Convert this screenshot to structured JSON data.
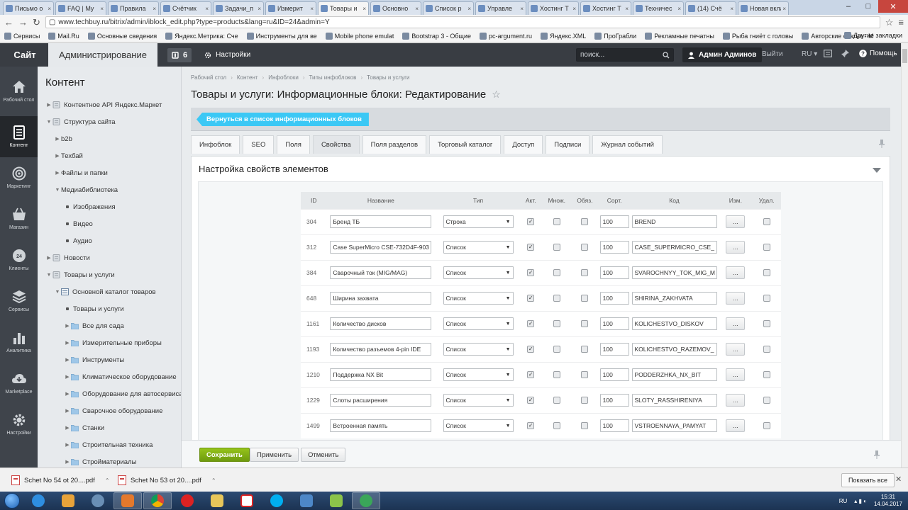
{
  "browser": {
    "tabs": [
      {
        "title": "Письмо о"
      },
      {
        "title": "FAQ | My"
      },
      {
        "title": "Правила"
      },
      {
        "title": "Счётчик"
      },
      {
        "title": "Задачи_п"
      },
      {
        "title": "Измерит"
      },
      {
        "title": "Товары и"
      },
      {
        "title": "Основно"
      },
      {
        "title": "Список р"
      },
      {
        "title": "Управле"
      },
      {
        "title": "Хостинг T"
      },
      {
        "title": "Хостинг T"
      },
      {
        "title": "Техничес"
      },
      {
        "title": "(14) Счё"
      },
      {
        "title": "Новая вклад"
      }
    ],
    "url": "www.techbuy.ru/bitrix/admin/iblock_edit.php?type=products&lang=ru&ID=24&admin=Y",
    "bookmarks": [
      "Сервисы",
      "Mail.Ru",
      "Основные сведения",
      "Яндекс.Метрика: Сче",
      "Инструменты для ве",
      "Mobile phone emulat",
      "Bootstrap 3 - Общие",
      "pc-argument.ru",
      "Яндекс.XML",
      "ПроГрабли",
      "Рекламные печатны",
      "Рыба гниёт с головы",
      "Авторские статьи - М"
    ],
    "other_bookmarks": "Другие закладки"
  },
  "topbar": {
    "site": "Сайт",
    "admin": "Администрирование",
    "notifications": "6",
    "settings": "Настройки",
    "search_placeholder": "поиск...",
    "user": "Админ Админов",
    "logout": "Выйти",
    "lang": "RU",
    "help": "Помощь"
  },
  "leftnav": [
    {
      "label": "Рабочий стол",
      "icon": "home-icon"
    },
    {
      "label": "Контент",
      "icon": "document-icon"
    },
    {
      "label": "Маркетинг",
      "icon": "target-icon"
    },
    {
      "label": "Магазин",
      "icon": "basket-icon"
    },
    {
      "label": "Клиенты",
      "icon": "clients-icon"
    },
    {
      "label": "Сервисы",
      "icon": "layers-icon"
    },
    {
      "label": "Аналитика",
      "icon": "chart-icon"
    },
    {
      "label": "Marketplace",
      "icon": "cloud-icon"
    },
    {
      "label": "Настройки",
      "icon": "gear-icon"
    }
  ],
  "tree": {
    "title": "Контент",
    "items": [
      {
        "label": "Контентное API Яндекс.Маркет",
        "level": 0,
        "icon": "page",
        "arrow": "right"
      },
      {
        "label": "Структура сайта",
        "level": 0,
        "icon": "page",
        "arrow": "down"
      },
      {
        "label": "b2b",
        "level": 1,
        "icon": "none",
        "arrow": "right"
      },
      {
        "label": "Техбай",
        "level": 1,
        "icon": "none",
        "arrow": "right"
      },
      {
        "label": "Файлы и папки",
        "level": 1,
        "icon": "none",
        "arrow": "right"
      },
      {
        "label": "Медиабиблиотека",
        "level": 1,
        "icon": "none",
        "arrow": "down"
      },
      {
        "label": "Изображения",
        "level": 2,
        "icon": "dot",
        "arrow": "none"
      },
      {
        "label": "Видео",
        "level": 2,
        "icon": "dot",
        "arrow": "none"
      },
      {
        "label": "Аудио",
        "level": 2,
        "icon": "dot",
        "arrow": "none"
      },
      {
        "label": "Новости",
        "level": 0,
        "icon": "page",
        "arrow": "right"
      },
      {
        "label": "Товары и услуги",
        "level": 0,
        "icon": "page",
        "arrow": "down"
      },
      {
        "label": "Основной каталог товаров",
        "level": 1,
        "icon": "catalog",
        "arrow": "down"
      },
      {
        "label": "Товары и услуги",
        "level": 2,
        "icon": "dot",
        "arrow": "none"
      },
      {
        "label": "Все для сада",
        "level": 2,
        "icon": "folder",
        "arrow": "right"
      },
      {
        "label": "Измерительные приборы",
        "level": 2,
        "icon": "folder",
        "arrow": "right"
      },
      {
        "label": "Инструменты",
        "level": 2,
        "icon": "folder",
        "arrow": "right"
      },
      {
        "label": "Климатическое оборудование",
        "level": 2,
        "icon": "folder",
        "arrow": "right"
      },
      {
        "label": "Оборудование для автосервиса",
        "level": 2,
        "icon": "folder",
        "arrow": "right"
      },
      {
        "label": "Сварочное оборудование",
        "level": 2,
        "icon": "folder",
        "arrow": "right"
      },
      {
        "label": "Станки",
        "level": 2,
        "icon": "folder",
        "arrow": "right"
      },
      {
        "label": "Строительная техника",
        "level": 2,
        "icon": "folder",
        "arrow": "right"
      },
      {
        "label": "Стройматериалы",
        "level": 2,
        "icon": "folder",
        "arrow": "right"
      }
    ]
  },
  "breadcrumb": [
    "Рабочий стол",
    "Контент",
    "Инфоблоки",
    "Типы инфоблоков",
    "Товары и услуги"
  ],
  "page_title": "Товары и услуги: Информационные блоки: Редактирование",
  "back_button": "Вернуться в список информационных блоков",
  "tabs": [
    "Инфоблок",
    "SEO",
    "Поля",
    "Свойства",
    "Поля разделов",
    "Торговый каталог",
    "Доступ",
    "Подписи",
    "Журнал событий"
  ],
  "active_tab": "Свойства",
  "section_title": "Настройка свойств элементов",
  "table": {
    "headers": [
      "ID",
      "Название",
      "Тип",
      "Акт.",
      "Множ.",
      "Обяз.",
      "Сорт.",
      "Код",
      "Изм.",
      "Удал."
    ],
    "edit_label": "...",
    "rows": [
      {
        "id": "304",
        "name": "Бренд ТБ",
        "type": "Строка",
        "active": true,
        "multiple": false,
        "required": false,
        "sort": "100",
        "code": "BREND",
        "delete": false
      },
      {
        "id": "312",
        "name": "Case SuperMicro CSE-732D4F-903",
        "type": "Список",
        "active": true,
        "multiple": false,
        "required": false,
        "sort": "100",
        "code": "CASE_SUPERMICRO_CSE_",
        "delete": false
      },
      {
        "id": "384",
        "name": "Сварочный ток (MIG/MAG)",
        "type": "Список",
        "active": true,
        "multiple": false,
        "required": false,
        "sort": "100",
        "code": "SVAROCHNYY_TOK_MIG_M",
        "delete": false
      },
      {
        "id": "648",
        "name": "Ширина захвата",
        "type": "Список",
        "active": true,
        "multiple": false,
        "required": false,
        "sort": "100",
        "code": "SHIRINA_ZAKHVATA",
        "delete": false
      },
      {
        "id": "1161",
        "name": "Количество дисков",
        "type": "Список",
        "active": true,
        "multiple": false,
        "required": false,
        "sort": "100",
        "code": "KOLICHESTVO_DISKOV",
        "delete": false
      },
      {
        "id": "1193",
        "name": "Количество разъемов 4-pin IDE",
        "type": "Список",
        "active": true,
        "multiple": false,
        "required": false,
        "sort": "100",
        "code": "KOLICHESTVO_RAZEMOV_",
        "delete": false
      },
      {
        "id": "1210",
        "name": "Поддержка NX Bit",
        "type": "Список",
        "active": true,
        "multiple": false,
        "required": false,
        "sort": "100",
        "code": "PODDERZHKA_NX_BIT",
        "delete": false
      },
      {
        "id": "1229",
        "name": "Слоты расширения",
        "type": "Список",
        "active": true,
        "multiple": false,
        "required": false,
        "sort": "100",
        "code": "SLOTY_RASSHIRENIYA",
        "delete": false
      },
      {
        "id": "1499",
        "name": "Встроенная память",
        "type": "Список",
        "active": true,
        "multiple": false,
        "required": false,
        "sort": "100",
        "code": "VSTROENNAYA_PAMYAT",
        "delete": false
      }
    ]
  },
  "actions": {
    "save": "Сохранить",
    "apply": "Применить",
    "cancel": "Отменить"
  },
  "downloads": {
    "items": [
      "Schet No 54 ot 20....pdf",
      "Schet No 53 ot 20....pdf"
    ],
    "show_all": "Показать все"
  },
  "taskbar": {
    "lang": "RU",
    "time": "15:31",
    "date": "14.04.2017"
  },
  "colors": {
    "topbar": "#393d43",
    "leftnav": "#3f444b",
    "back_button": "#3bc8f5",
    "save_button": "#7fae14"
  }
}
